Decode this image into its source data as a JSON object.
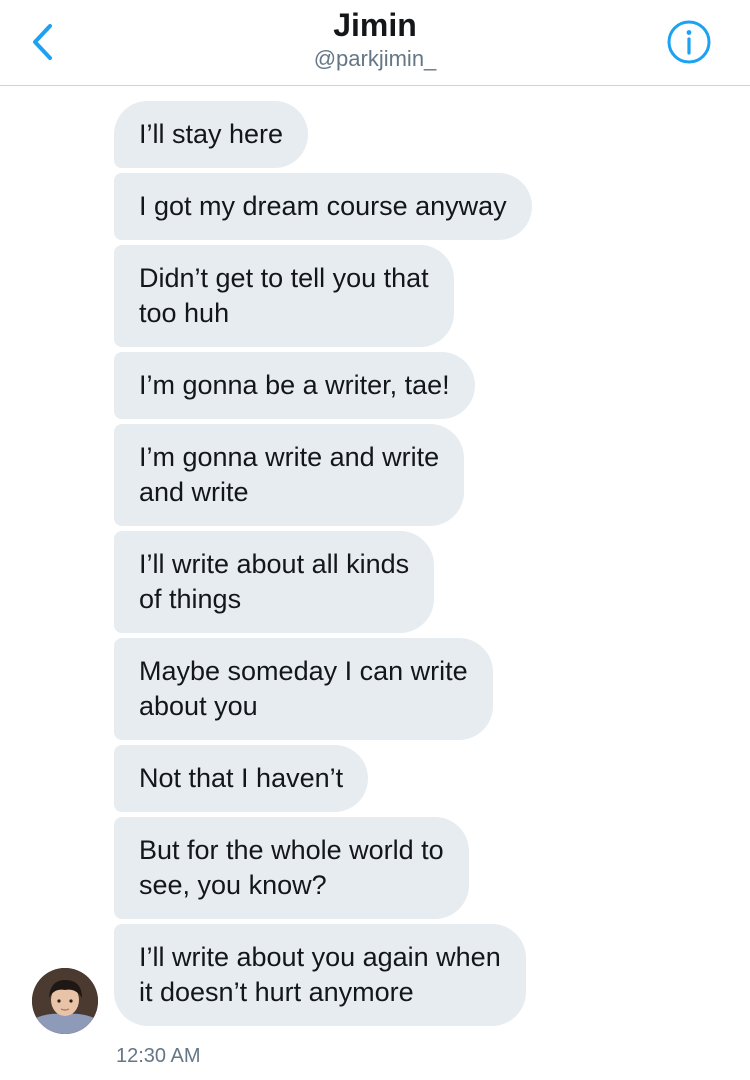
{
  "header": {
    "title": "Jimin",
    "handle": "@parkjimin_",
    "back_icon": "chevron-left-icon",
    "info_icon": "info-circle-icon",
    "accent_color": "#1da1f2"
  },
  "conversation": {
    "messages": [
      {
        "text": "I’ll stay here"
      },
      {
        "text": "I got my dream course anyway"
      },
      {
        "text": "Didn’t get to tell you that\ntoo huh"
      },
      {
        "text": "I’m gonna be a writer, tae!"
      },
      {
        "text": "I’m gonna write and write\nand write"
      },
      {
        "text": "I’ll write about all kinds\nof things"
      },
      {
        "text": "Maybe someday I can write\nabout you"
      },
      {
        "text": "Not that I haven’t"
      },
      {
        "text": "But for the whole world to\nsee, you know?"
      },
      {
        "text": "I’ll write about you again when\nit doesn’t hurt anymore"
      }
    ],
    "timestamp": "12:30 AM",
    "bubble_color": "#e6ecf0"
  }
}
